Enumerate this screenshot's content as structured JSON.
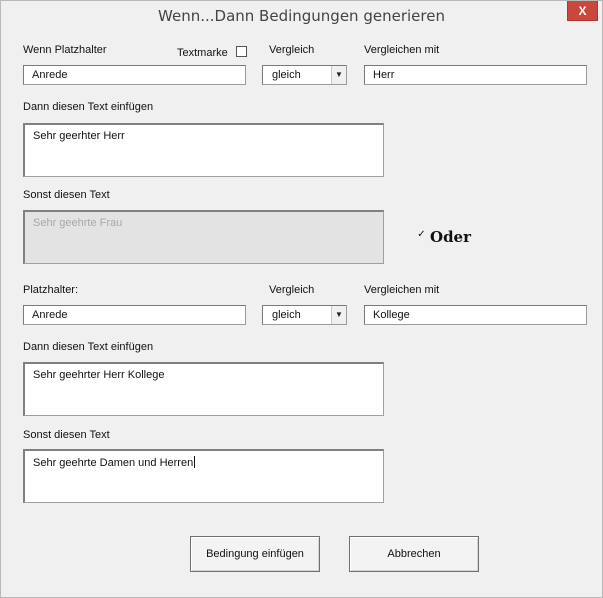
{
  "window": {
    "title": "Wenn...Dann Bedingungen generieren",
    "close_symbol": "X"
  },
  "condition1": {
    "placeholder_label": "Wenn Platzhalter",
    "placeholder_value": "Anrede",
    "bookmark_label": "Textmarke",
    "bookmark_checked": false,
    "compare_label": "Vergleich",
    "compare_value": "gleich",
    "compare_with_label": "Vergleichen mit",
    "compare_with_value": "Herr",
    "then_label": "Dann diesen Text einfügen",
    "then_value": "Sehr geerhter Herr",
    "else_label": "Sonst diesen Text",
    "else_value": "Sehr geehrte Frau"
  },
  "oder": {
    "label": "Oder",
    "checked": true,
    "check_mark": "✓"
  },
  "condition2": {
    "placeholder_label": "Platzhalter:",
    "placeholder_value": "Anrede",
    "compare_label": "Vergleich",
    "compare_value": "gleich",
    "compare_with_label": "Vergleichen mit",
    "compare_with_value": "Kollege",
    "then_label": "Dann diesen Text einfügen",
    "then_value": "Sehr geehrter Herr Kollege",
    "else_label": "Sonst diesen Text",
    "else_value": "Sehr geehrte Damen und Herren"
  },
  "buttons": {
    "insert_label": "Bedingung einfügen",
    "cancel_label": "Abbrechen"
  },
  "icons": {
    "dropdown_arrow": "▼"
  }
}
